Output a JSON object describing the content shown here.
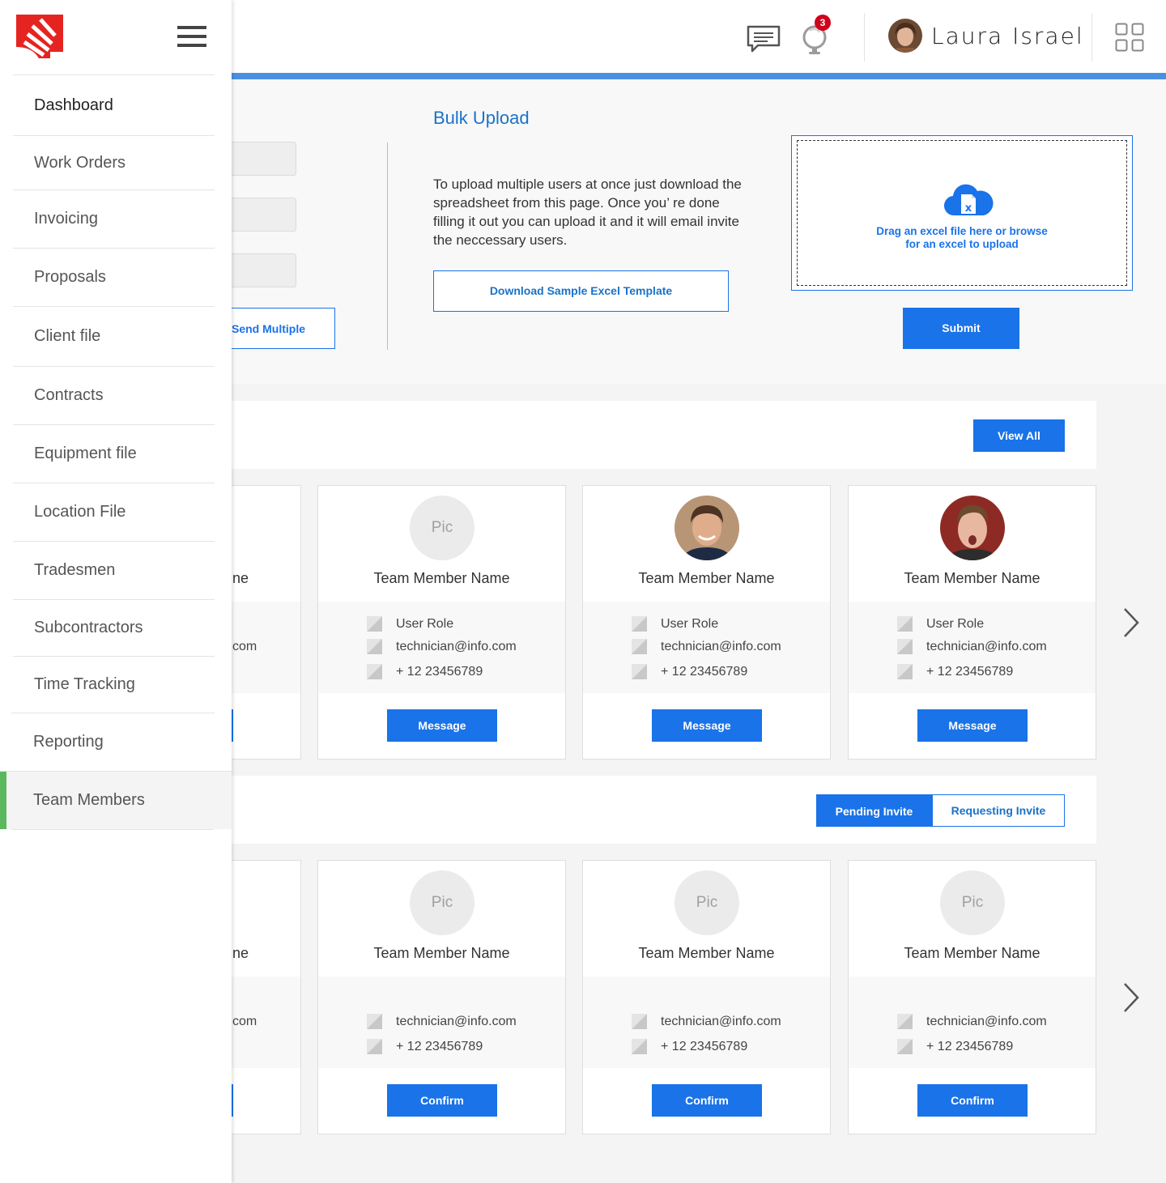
{
  "header": {
    "user_name": "Laura Israel",
    "notification_count": "3"
  },
  "sidebar": {
    "items": [
      {
        "label": "Dashboard"
      },
      {
        "label": "Work Orders"
      },
      {
        "label": "Invoicing"
      },
      {
        "label": "Proposals"
      },
      {
        "label": "Client file"
      },
      {
        "label": "Contracts"
      },
      {
        "label": "Equipment file"
      },
      {
        "label": "Location File"
      },
      {
        "label": "Tradesmen"
      },
      {
        "label": "Subcontractors"
      },
      {
        "label": "Time Tracking"
      },
      {
        "label": "Reporting"
      },
      {
        "label": "Team Members"
      }
    ],
    "active_item": "Team Members"
  },
  "invite": {
    "send_multiple_label": "Send Multiple"
  },
  "bulk_upload": {
    "title": "Bulk Upload",
    "description": "To upload multiple users at once just download the spreadsheet from this page. Once you’ re done filling it out you can upload it and it will email invite the neccessary users.",
    "download_label": "Download Sample Excel Template",
    "drop_line1": "Drag an excel file here or browse",
    "drop_line2": "for an excel to upload",
    "submit_label": "Submit"
  },
  "team": {
    "view_all_label": "View All",
    "partial_card": {
      "name_fragment": "ne",
      "email_fragment": "com"
    },
    "cards": [
      {
        "pic": "Pic",
        "name": "Team Member Name",
        "role": "User Role",
        "email": "technician@info.com",
        "phone": "+ 12 23456789",
        "action": "Message"
      },
      {
        "pic": "",
        "name": "Team Member Name",
        "role": "User Role",
        "email": "technician@info.com",
        "phone": "+ 12 23456789",
        "action": "Message"
      },
      {
        "pic": "",
        "name": "Team Member Name",
        "role": "User Role",
        "email": "technician@info.com",
        "phone": "+ 12 23456789",
        "action": "Message"
      }
    ]
  },
  "invites": {
    "tabs": [
      {
        "label": "Pending Invite",
        "selected": true
      },
      {
        "label": "Requesting Invite",
        "selected": false
      }
    ],
    "partial_card": {
      "name_fragment": "ne",
      "email_fragment": "com"
    },
    "cards": [
      {
        "pic": "Pic",
        "name": "Team Member Name",
        "email": "technician@info.com",
        "phone": "+ 12 23456789",
        "action": "Confirm"
      },
      {
        "pic": "Pic",
        "name": "Team Member Name",
        "email": "technician@info.com",
        "phone": "+ 12 23456789",
        "action": "Confirm"
      },
      {
        "pic": "Pic",
        "name": "Team Member Name",
        "email": "technician@info.com",
        "phone": "+ 12 23456789",
        "action": "Confirm"
      }
    ]
  },
  "colors": {
    "primary": "#1a73e8",
    "accent_bar": "#4a90e2",
    "active_nav": "#5cb85c",
    "badge": "#d0021b"
  }
}
